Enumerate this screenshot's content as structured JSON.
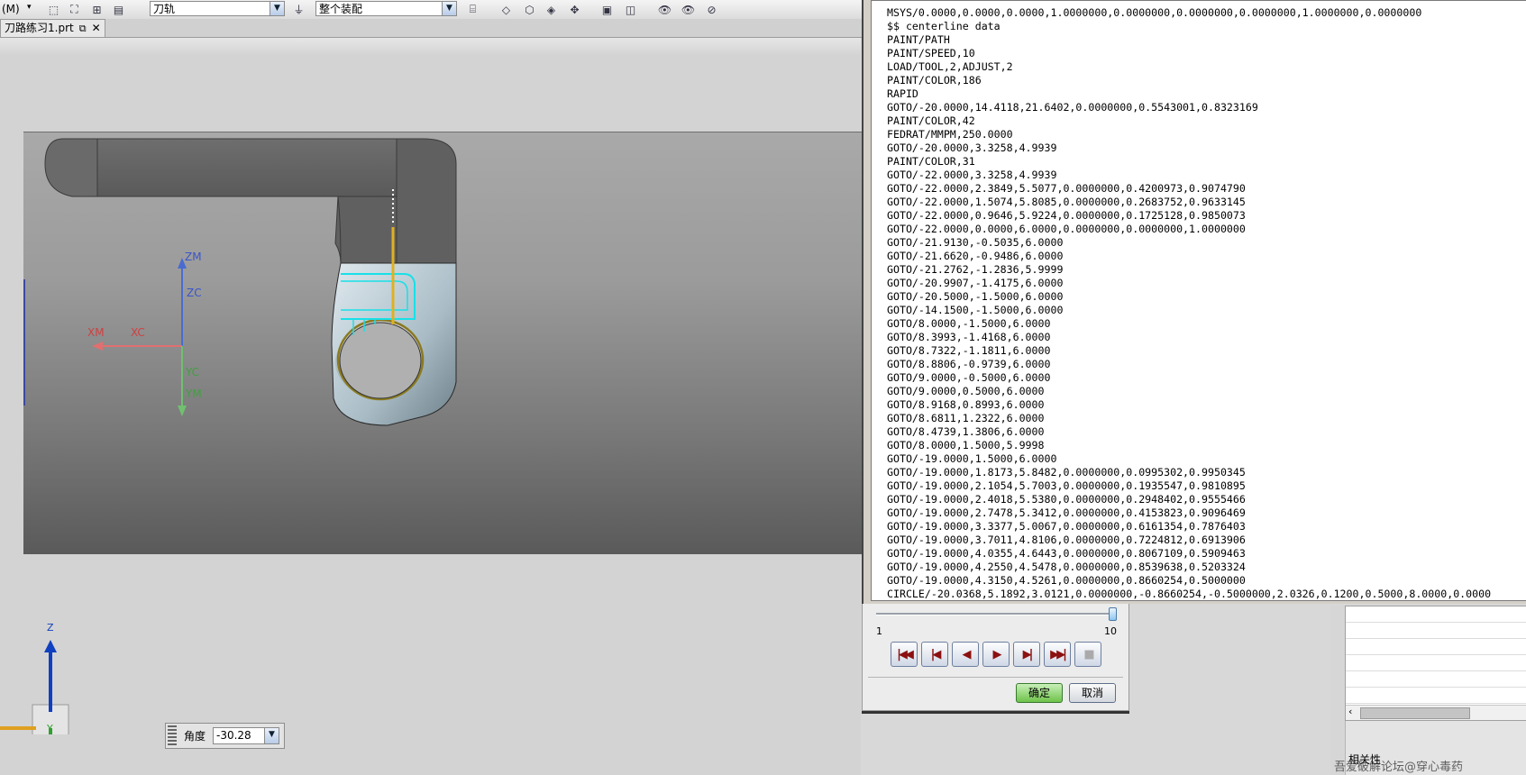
{
  "toolbar": {
    "menu_label": "(M)",
    "filter_dropdown": "刀轨",
    "assembly_dropdown": "整个装配"
  },
  "tab": {
    "title": "刀路练习1.prt"
  },
  "triad": {
    "zm": "ZM",
    "zc": "ZC",
    "xm": "XM",
    "xc": "XC",
    "yc": "YC",
    "ym": "YM"
  },
  "view_triad": {
    "z": "Z",
    "y": "Y"
  },
  "angle": {
    "label": "角度",
    "value": "-30.28"
  },
  "listing": {
    "lines": [
      "MSYS/0.0000,0.0000,0.0000,1.0000000,0.0000000,0.0000000,0.0000000,1.0000000,0.0000000",
      "$$ centerline data",
      "PAINT/PATH",
      "PAINT/SPEED,10",
      "LOAD/TOOL,2,ADJUST,2",
      "PAINT/COLOR,186",
      "RAPID",
      "GOTO/-20.0000,14.4118,21.6402,0.0000000,0.5543001,0.8323169",
      "PAINT/COLOR,42",
      "FEDRAT/MMPM,250.0000",
      "GOTO/-20.0000,3.3258,4.9939",
      "PAINT/COLOR,31",
      "GOTO/-22.0000,3.3258,4.9939",
      "GOTO/-22.0000,2.3849,5.5077,0.0000000,0.4200973,0.9074790",
      "GOTO/-22.0000,1.5074,5.8085,0.0000000,0.2683752,0.9633145",
      "GOTO/-22.0000,0.9646,5.9224,0.0000000,0.1725128,0.9850073",
      "GOTO/-22.0000,0.0000,6.0000,0.0000000,0.0000000,1.0000000",
      "GOTO/-21.9130,-0.5035,6.0000",
      "GOTO/-21.6620,-0.9486,6.0000",
      "GOTO/-21.2762,-1.2836,5.9999",
      "GOTO/-20.9907,-1.4175,6.0000",
      "GOTO/-20.5000,-1.5000,6.0000",
      "GOTO/-14.1500,-1.5000,6.0000",
      "GOTO/8.0000,-1.5000,6.0000",
      "GOTO/8.3993,-1.4168,6.0000",
      "GOTO/8.7322,-1.1811,6.0000",
      "GOTO/8.8806,-0.9739,6.0000",
      "GOTO/9.0000,-0.5000,6.0000",
      "GOTO/9.0000,0.5000,6.0000",
      "GOTO/8.9168,0.8993,6.0000",
      "GOTO/8.6811,1.2322,6.0000",
      "GOTO/8.4739,1.3806,6.0000",
      "GOTO/8.0000,1.5000,5.9998",
      "GOTO/-19.0000,1.5000,6.0000",
      "GOTO/-19.0000,1.8173,5.8482,0.0000000,0.0995302,0.9950345",
      "GOTO/-19.0000,2.1054,5.7003,0.0000000,0.1935547,0.9810895",
      "GOTO/-19.0000,2.4018,5.5380,0.0000000,0.2948402,0.9555466",
      "GOTO/-19.0000,2.7478,5.3412,0.0000000,0.4153823,0.9096469",
      "GOTO/-19.0000,3.3377,5.0067,0.0000000,0.6161354,0.7876403",
      "GOTO/-19.0000,3.7011,4.8106,0.0000000,0.7224812,0.6913906",
      "GOTO/-19.0000,4.0355,4.6443,0.0000000,0.8067109,0.5909463",
      "GOTO/-19.0000,4.2550,4.5478,0.0000000,0.8539638,0.5203324",
      "GOTO/-19.0000,4.3150,4.5261,0.0000000,0.8660254,0.5000000",
      "CIRCLE/-20.0368,5.1892,3.0121,0.0000000,-0.8660254,-0.5000000,2.0326,0.1200,0.5000,8.0000,0.0000"
    ]
  },
  "animation": {
    "speed_min": "1",
    "speed_max": "10",
    "speed_value": 10,
    "ok_label": "确定",
    "cancel_label": "取消"
  },
  "right_panel": {
    "section_label": "相关性"
  },
  "watermark": "吾爱破解论坛@穿心毒药"
}
